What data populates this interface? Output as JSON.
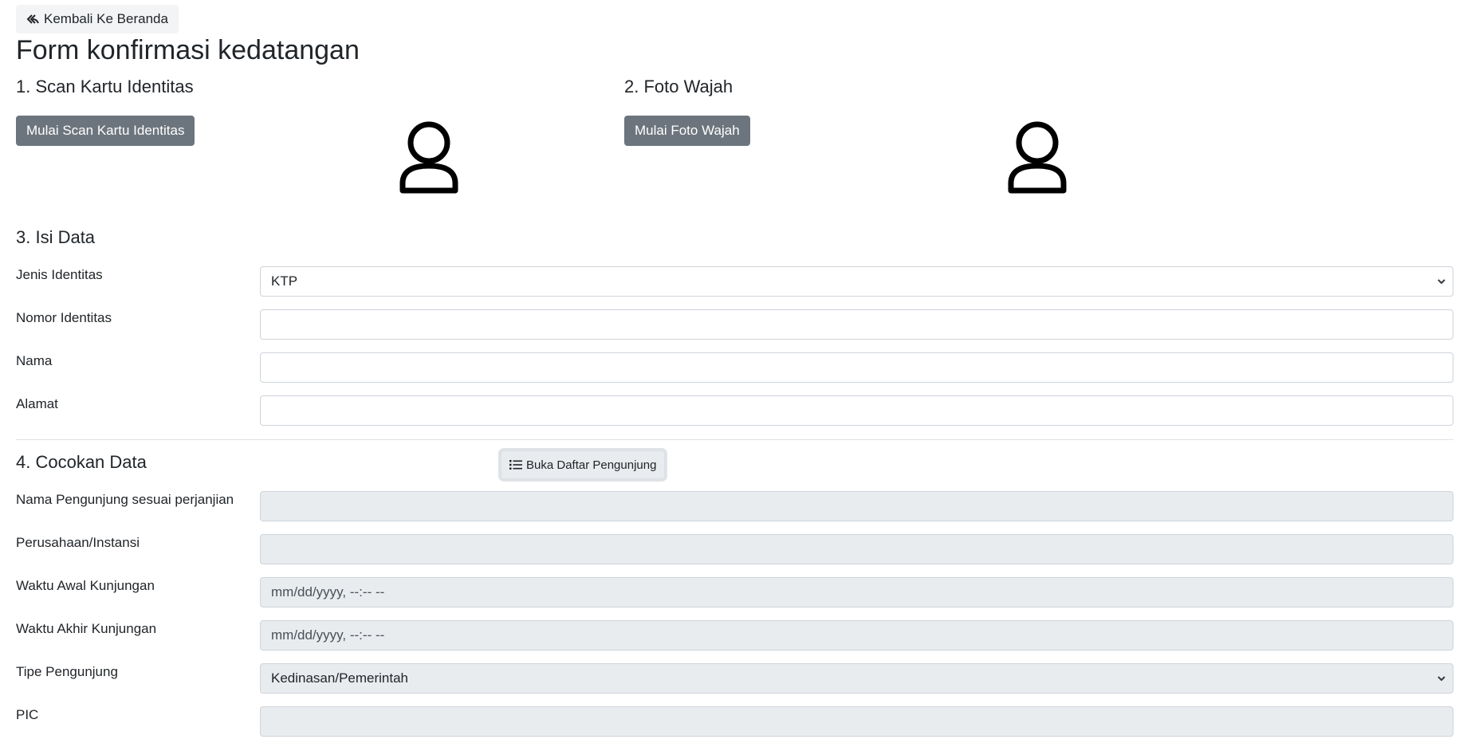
{
  "header": {
    "back_label": "Kembali Ke Beranda",
    "title": "Form konfirmasi kedatangan"
  },
  "step1": {
    "title": "1. Scan Kartu Identitas",
    "button": "Mulai Scan Kartu Identitas",
    "icon": "person-outline-icon"
  },
  "step2": {
    "title": "2. Foto Wajah",
    "button": "Mulai Foto Wajah",
    "icon": "person-outline-icon"
  },
  "step3": {
    "title": "3. Isi Data",
    "fields": {
      "jenis_identitas": {
        "label": "Jenis Identitas",
        "value": "KTP"
      },
      "nomor_identitas": {
        "label": "Nomor Identitas",
        "value": ""
      },
      "nama": {
        "label": "Nama",
        "value": ""
      },
      "alamat": {
        "label": "Alamat",
        "value": ""
      }
    }
  },
  "step4": {
    "title": "4. Cocokan Data",
    "list_button": "Buka Daftar Pengunjung",
    "fields": {
      "nama_pengunjung": {
        "label": "Nama Pengunjung sesuai perjanjian",
        "value": ""
      },
      "perusahaan": {
        "label": "Perusahaan/Instansi",
        "value": ""
      },
      "waktu_awal": {
        "label": "Waktu Awal Kunjungan",
        "placeholder": "mm/dd/yyyy, --:-- --"
      },
      "waktu_akhir": {
        "label": "Waktu Akhir Kunjungan",
        "placeholder": "mm/dd/yyyy, --:-- --"
      },
      "tipe_pengunjung": {
        "label": "Tipe Pengunjung",
        "value": "Kedinasan/Pemerintah"
      },
      "pic": {
        "label": "PIC",
        "value": ""
      }
    }
  }
}
